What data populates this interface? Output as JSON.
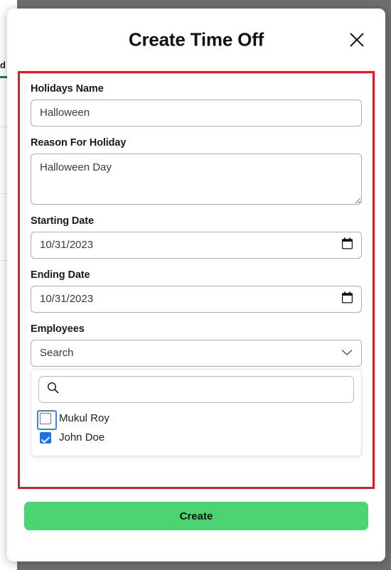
{
  "background": {
    "tab_label_partial": "d",
    "accent_color": "#1f7a45"
  },
  "modal": {
    "title": "Create Time Off",
    "close_icon": "close-icon",
    "form": {
      "fields": [
        {
          "label": "Holidays Name",
          "value": "Halloween",
          "placeholder": "Holidays Name",
          "type": "text"
        },
        {
          "label": "Reason For Holiday",
          "value": "Halloween Day",
          "placeholder": "Reason For Holiday",
          "type": "textarea"
        },
        {
          "label": "Starting Date",
          "value": "10/31/2023",
          "placeholder": "mm/dd/yyyy",
          "type": "date",
          "icon": "calendar-icon"
        },
        {
          "label": "Ending Date",
          "value": "10/31/2023",
          "placeholder": "mm/dd/yyyy",
          "type": "date",
          "icon": "calendar-icon"
        },
        {
          "label": "Employees",
          "value": "Search",
          "placeholder": "Search",
          "type": "select",
          "icon": "chevron-down-icon"
        }
      ],
      "highlight_color": "#e01b24"
    },
    "dropdown": {
      "search_value": "",
      "search_placeholder": "",
      "search_icon": "search-icon",
      "options": [
        {
          "name": "Mukul Roy",
          "checked": false,
          "focused": true
        },
        {
          "name": "John Doe",
          "checked": true,
          "focused": false
        }
      ],
      "checked_color": "#1a73e8"
    },
    "footer": {
      "submit_label": "Create",
      "submit_color": "#4ad572"
    }
  }
}
